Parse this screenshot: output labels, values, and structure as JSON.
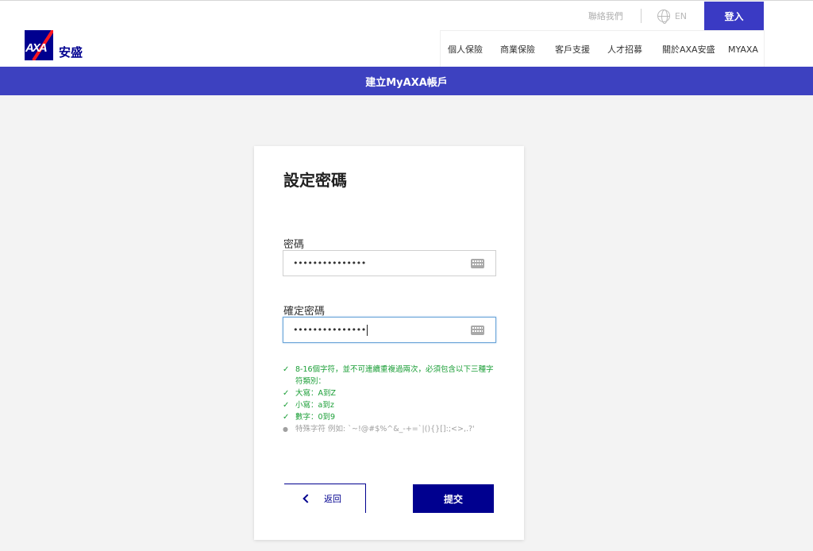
{
  "brand": {
    "logo_text": "AXA",
    "name": "安盛"
  },
  "utility": {
    "contact": "聯絡我們",
    "language": "EN",
    "login": "登入"
  },
  "nav": [
    "個人保險",
    "商業保險",
    "客戶支援",
    "人才招募",
    "關於AXA安盛",
    "MYAXA"
  ],
  "banner": {
    "title": "建立MyAXA帳戶"
  },
  "form": {
    "title": "設定密碼",
    "password": {
      "label": "密碼",
      "value": "•••••••••••••••"
    },
    "confirm": {
      "label": "確定密碼",
      "value": "•••••••••••••••"
    },
    "rules": [
      {
        "text": "8‑16個字符，並不可連續重複過兩次，必須包含以下三種字符類別：",
        "status": "met",
        "mark": "✓"
      },
      {
        "text": "大寫：A到Z",
        "status": "met",
        "mark": "✓"
      },
      {
        "text": "小寫：a到z",
        "status": "met",
        "mark": "✓"
      },
      {
        "text": "數字：0到9",
        "status": "met",
        "mark": "✓"
      },
      {
        "text": "特殊字符 例如: `~!@#$%^&_-+=`|(){}[]:;<>,.?'",
        "status": "pending",
        "mark": "●"
      }
    ],
    "back": "返回",
    "submit": "提交"
  }
}
